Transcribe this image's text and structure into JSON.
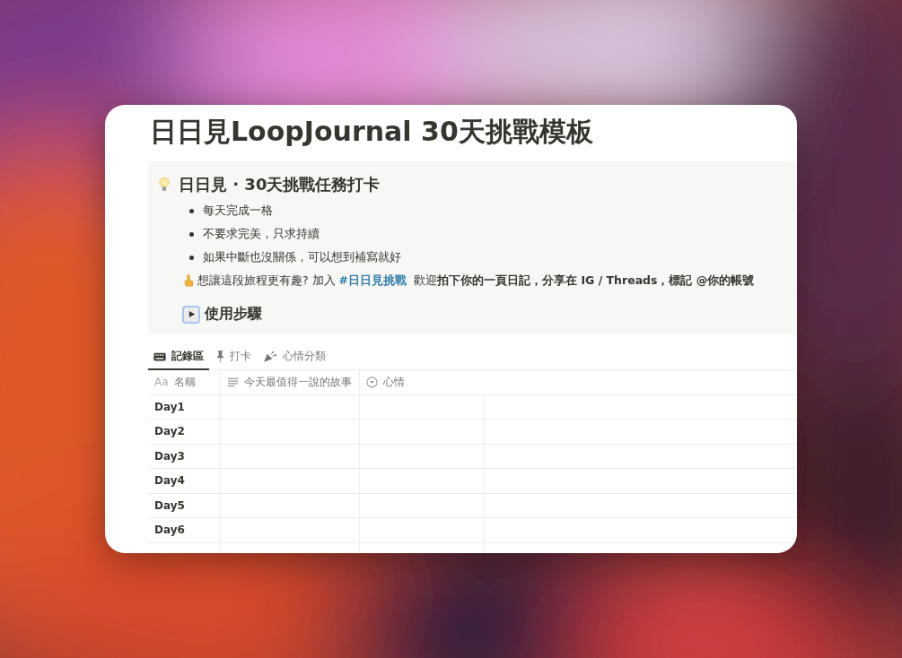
{
  "page": {
    "title": "日日見LoopJournal 30天挑戰模板"
  },
  "callout": {
    "heading": "日日見 · 30天挑戰任務打卡",
    "bullets": [
      "每天完成一格",
      "不要求完美，只求持續",
      "如果中斷也沒關係，可以想到補寫就好"
    ],
    "note": {
      "prefix": "想讓這段旅程更有趣?  加入",
      "link": "#日日見挑戰",
      "suffix": "歡迎**拍下你的一頁日記，分享在 IG / Threads，標記 @你的帳號**"
    },
    "toggle": {
      "label": "使用步驟",
      "expanded": false
    }
  },
  "tabs": [
    {
      "label": "記錄區",
      "kind": "keyboard",
      "selected": true
    },
    {
      "label": "打卡",
      "kind": "pin",
      "selected": false
    },
    {
      "label": "心情分類",
      "kind": "party",
      "selected": false
    }
  ],
  "table": {
    "columns": [
      {
        "label": "名稱",
        "kind": "title",
        "icon_text": "Aa"
      },
      {
        "label": "今天最值得一說的故事",
        "kind": "text"
      },
      {
        "label": "心情",
        "kind": "select"
      }
    ],
    "rows": [
      {
        "name": "Day1"
      },
      {
        "name": "Day2"
      },
      {
        "name": "Day3"
      },
      {
        "name": "Day4"
      },
      {
        "name": "Day5"
      },
      {
        "name": "Day6"
      }
    ]
  }
}
